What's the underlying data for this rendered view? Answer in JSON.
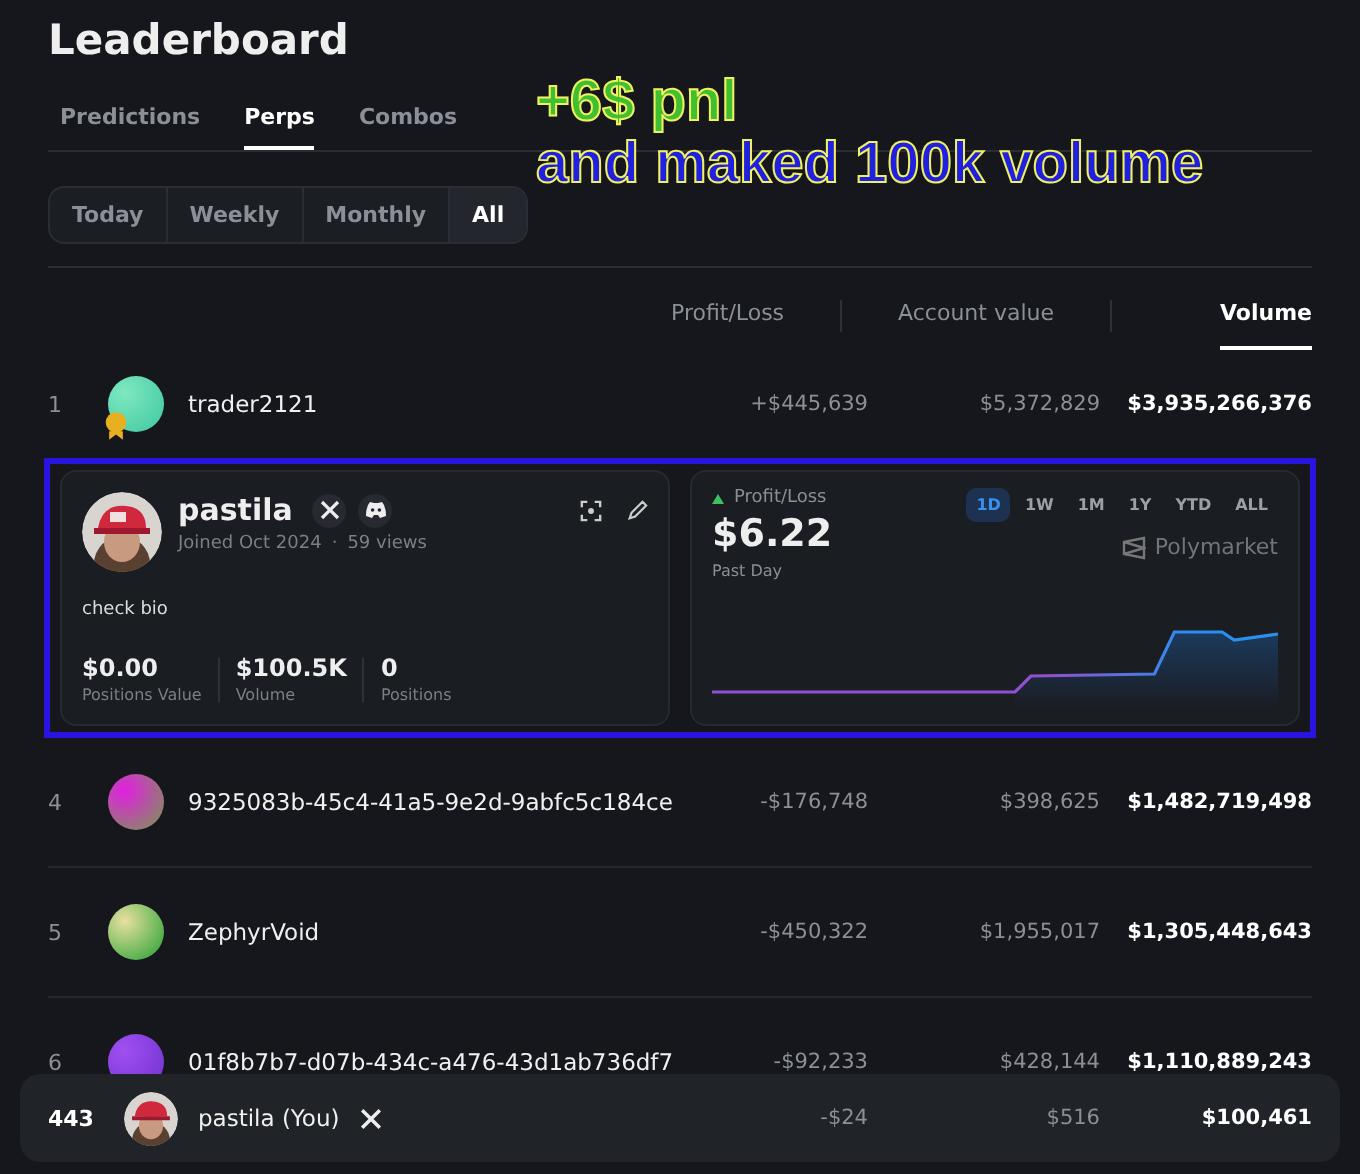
{
  "title": "Leaderboard",
  "tabs": [
    {
      "label": "Predictions",
      "selected": false
    },
    {
      "label": "Perps",
      "selected": true
    },
    {
      "label": "Combos",
      "selected": false
    }
  ],
  "periods": [
    {
      "label": "Today",
      "selected": false
    },
    {
      "label": "Weekly",
      "selected": false
    },
    {
      "label": "Monthly",
      "selected": false
    },
    {
      "label": "All",
      "selected": true
    }
  ],
  "annotation": {
    "line_1": "+6$ pnl",
    "line_2": "and maked 100k volume"
  },
  "columns": [
    {
      "label": "Profit/Loss",
      "selected": false
    },
    {
      "label": "Account value",
      "selected": false
    },
    {
      "label": "Volume",
      "selected": true
    }
  ],
  "rows_top": [
    {
      "rank": "1",
      "name": "trader2121",
      "pnl": "+$445,639",
      "account_value": "$5,372,829",
      "volume": "$3,935,266,376",
      "medal": true
    }
  ],
  "profile_card": {
    "name": "pastila",
    "joined": "Joined Oct 2024",
    "views": "59 views",
    "separator": "·",
    "bio": "check bio",
    "stats": [
      {
        "value": "$0.00",
        "label": "Positions Value"
      },
      {
        "value": "$100.5K",
        "label": "Volume"
      },
      {
        "value": "0",
        "label": "Positions"
      }
    ]
  },
  "pnl_card": {
    "label": "Profit/Loss",
    "value": "$6.22",
    "period_label": "Past Day",
    "brand": "Polymarket",
    "ranges": [
      {
        "label": "1D",
        "selected": true
      },
      {
        "label": "1W",
        "selected": false
      },
      {
        "label": "1M",
        "selected": false
      },
      {
        "label": "1Y",
        "selected": false
      },
      {
        "label": "YTD",
        "selected": false
      },
      {
        "label": "ALL",
        "selected": false
      }
    ]
  },
  "rows": [
    {
      "rank": "4",
      "name": "9325083b-45c4-41a5-9e2d-9abfc5c184ce",
      "pnl": "-$176,748",
      "account_value": "$398,625",
      "volume": "$1,482,719,498",
      "medal": false
    },
    {
      "rank": "5",
      "name": "ZephyrVoid",
      "pnl": "-$450,322",
      "account_value": "$1,955,017",
      "volume": "$1,305,448,643",
      "medal": false
    },
    {
      "rank": "6",
      "name": "01f8b7b7-d07b-434c-a476-43d1ab736df7",
      "pnl": "-$92,233",
      "account_value": "$428,144",
      "volume": "$1,110,889,243",
      "medal": false
    }
  ],
  "you_row": {
    "rank": "443",
    "name": "pastila (You)",
    "pnl": "-$24",
    "account_value": "$516",
    "volume": "$100,461"
  }
}
